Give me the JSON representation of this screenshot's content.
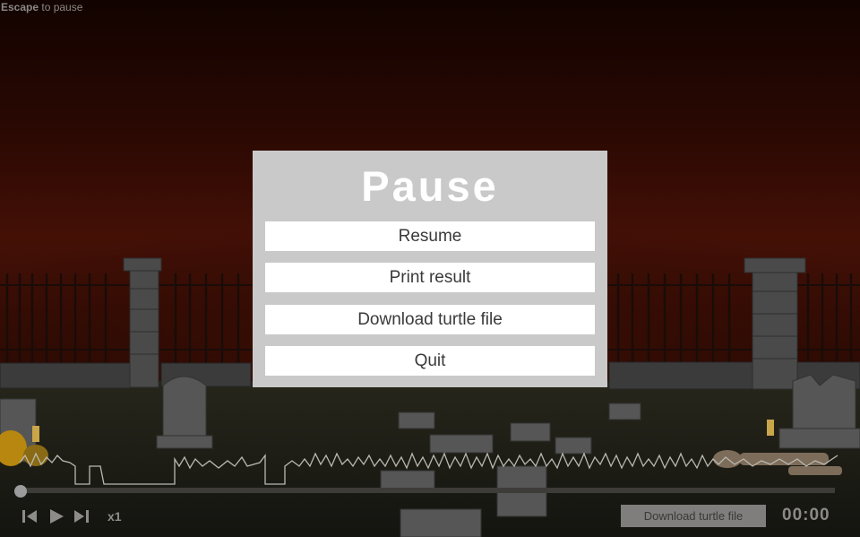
{
  "hud": {
    "hint_key": "Escape",
    "hint_text": " to pause"
  },
  "pause_menu": {
    "title": "Pause",
    "buttons": [
      {
        "label": "Resume"
      },
      {
        "label": "Print result"
      },
      {
        "label": "Download turtle file"
      },
      {
        "label": "Quit"
      }
    ]
  },
  "player": {
    "progress": 0,
    "speed": "x1",
    "download_label": "Download turtle file",
    "time": "00:00",
    "icons": [
      "step-back-icon",
      "play-icon",
      "step-forward-icon"
    ]
  },
  "colors": {
    "sky_top": "#120300",
    "sky_mid": "#3e0d05",
    "ground": "#23241a",
    "panel": "#c9c9c9",
    "button": "#ffffff",
    "waveform": "#b9b9b0"
  }
}
